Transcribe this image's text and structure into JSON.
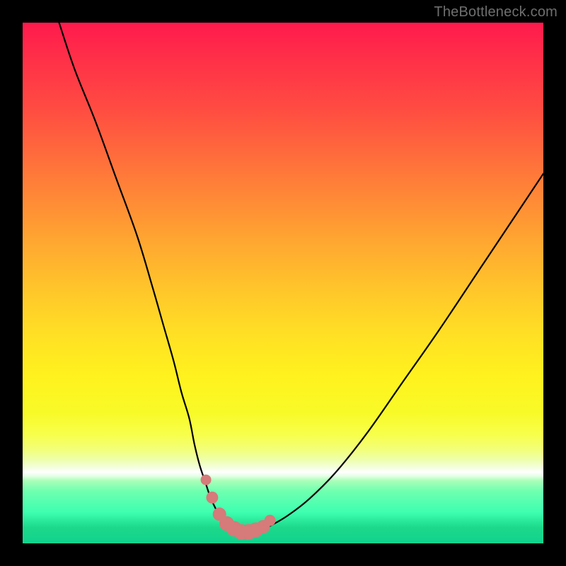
{
  "watermark": "TheBottleneck.com",
  "colors": {
    "background": "#000000",
    "curve_stroke": "#000000",
    "marker_fill": "#d67a7a",
    "marker_stroke": "#c96a6a"
  },
  "chart_data": {
    "type": "line",
    "title": "",
    "xlabel": "",
    "ylabel": "",
    "xlim": [
      0,
      100
    ],
    "ylim": [
      0,
      100
    ],
    "series": [
      {
        "name": "bottleneck-curve",
        "x": [
          7,
          10,
          14,
          18,
          22,
          25,
          27,
          29,
          30.5,
          32,
          33,
          34,
          35,
          36,
          37,
          38,
          39,
          40,
          41,
          42,
          43,
          44,
          45,
          46,
          48,
          51,
          55,
          60,
          66,
          73,
          80,
          88,
          96,
          100
        ],
        "values": [
          100,
          91,
          81,
          70,
          59,
          49,
          42,
          35,
          29,
          24,
          19,
          15,
          12,
          9,
          6.8,
          5.2,
          4,
          3.2,
          2.6,
          2.2,
          2,
          2,
          2.2,
          2.6,
          3.6,
          5.4,
          8.5,
          13.5,
          21,
          31,
          41,
          53,
          65,
          71
        ]
      }
    ],
    "markers": {
      "name": "trough-markers",
      "x": [
        35.2,
        36.4,
        37.8,
        39.2,
        40.6,
        42.0,
        43.4,
        44.8,
        46.2,
        47.5
      ],
      "values": [
        12.2,
        8.8,
        5.6,
        3.8,
        2.8,
        2.2,
        2.2,
        2.6,
        3.2,
        4.4
      ],
      "radius": [
        7.5,
        8.5,
        9.5,
        10.5,
        11,
        11,
        11,
        10.5,
        9.5,
        8
      ]
    }
  }
}
